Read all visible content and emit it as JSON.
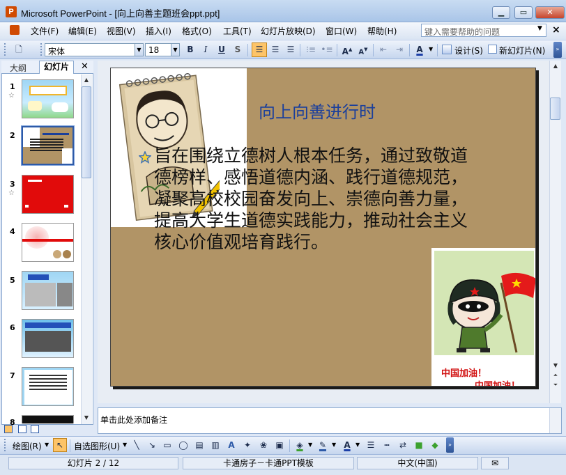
{
  "window": {
    "title": "Microsoft PowerPoint - [向上向善主题班会ppt.ppt]"
  },
  "menu": [
    "文件(F)",
    "编辑(E)",
    "视图(V)",
    "插入(I)",
    "格式(O)",
    "工具(T)",
    "幻灯片放映(D)",
    "窗口(W)",
    "帮助(H)"
  ],
  "help_placeholder": "键入需要帮助的问题",
  "toolbar": {
    "font_name": "宋体",
    "font_size": "18",
    "design_label": "设计(S)",
    "new_slide_label": "新幻灯片(N)"
  },
  "left_pane": {
    "tabs": [
      "大纲",
      "幻灯片"
    ],
    "thumbnails": [
      {
        "num": "1",
        "star": true
      },
      {
        "num": "2",
        "star": false,
        "selected": true
      },
      {
        "num": "3",
        "star": true
      },
      {
        "num": "4",
        "star": false
      },
      {
        "num": "5",
        "star": false
      },
      {
        "num": "6",
        "star": false
      },
      {
        "num": "7",
        "star": false
      },
      {
        "num": "8",
        "star": false
      }
    ]
  },
  "slide": {
    "title": "向上向善进行时",
    "body": "旨在围绕立德树人根本任务，通过致敬道德榜样、感悟道德内涵、践行道德规范，凝聚高校校园奋发向上、崇德向善力量，提高大学生道德实践能力，推动社会主义核心价值观培育践行。",
    "cheer_1": "中国加油！",
    "cheer_2": "中国加油！"
  },
  "notes": {
    "placeholder": "单击此处添加备注"
  },
  "drawing": {
    "draw_label": "绘图(R)",
    "autoshape_label": "自选图形(U)"
  },
  "status": {
    "slide_position": "幻灯片 2 / 12",
    "template": "卡通房子－卡通PPT模板",
    "language": "中文(中国)"
  },
  "colors": {
    "slide_background": "#b19466",
    "title_color": "#1b3f9b",
    "cheer_color": "#d10f0f"
  }
}
